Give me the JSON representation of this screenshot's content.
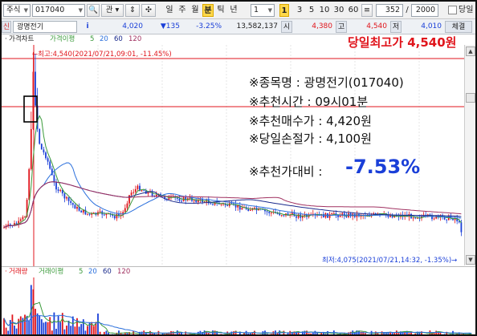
{
  "toolbar": {
    "market_select": "주식",
    "code_input": "017040",
    "view_label": "관",
    "period_buttons": [
      "일",
      "주",
      "월",
      "분",
      "틱",
      "년"
    ],
    "interval_value": "1",
    "badge": "1",
    "minute_options": [
      "3",
      "5",
      "10",
      "30",
      "60"
    ],
    "count_value": "352",
    "count_total": "2000",
    "today_label": "당일"
  },
  "infobar": {
    "prefix_label": "신",
    "stock_name": "광명전기",
    "info_icon": "i",
    "price": "4,020",
    "change": "▼135",
    "change_pct": "-3.25%",
    "volume": "13,582,137",
    "open_label": "시",
    "open_value": "4,380",
    "high_label": "고",
    "high_value": "4,540",
    "low_label": "저",
    "low_value": "4,010",
    "trade_label": "체결"
  },
  "chart": {
    "legend": [
      {
        "text": "가격차트",
        "color": "#222222"
      },
      {
        "text": "가격이평",
        "color": "#3a9a3a"
      },
      {
        "text": "5",
        "color": "#3a9a3a"
      },
      {
        "text": "20",
        "color": "#2a6fdc"
      },
      {
        "text": "60",
        "color": "#1a2a8c"
      },
      {
        "text": "120",
        "color": "#a03060"
      }
    ],
    "high_marker": "←최고:4,540(2021/07/21,09:01, -11.45%)",
    "low_marker": "최저:4,075(2021/07/21,14:32, -1.35%)→",
    "banner": "당일최고가 4,540원"
  },
  "info": {
    "line1": "※종목명 : 광명전기(017040)",
    "line2": "※추천시간 : 09시01분",
    "line3": "※추천매수가 : 4,420원",
    "line4": "※당일손절가 : 4,100원",
    "line5_prefix": "※추천가대비 :",
    "line5_value": "-7.53%"
  },
  "volume_panel": {
    "legend": [
      {
        "text": "거래량",
        "color": "#e0151c"
      },
      {
        "text": "거래이평",
        "color": "#3a9a3a"
      },
      {
        "text": "5",
        "color": "#3a9a3a"
      },
      {
        "text": "20",
        "color": "#2a6fdc"
      },
      {
        "text": "60",
        "color": "#1a2a8c"
      },
      {
        "text": "120",
        "color": "#a03060"
      }
    ]
  },
  "colors": {
    "up": "#e0151c",
    "down": "#1a3fd8",
    "ma5": "#3a9a3a",
    "ma20": "#2a6fdc",
    "ma60": "#1a2a8c",
    "ma120": "#a03060"
  }
}
